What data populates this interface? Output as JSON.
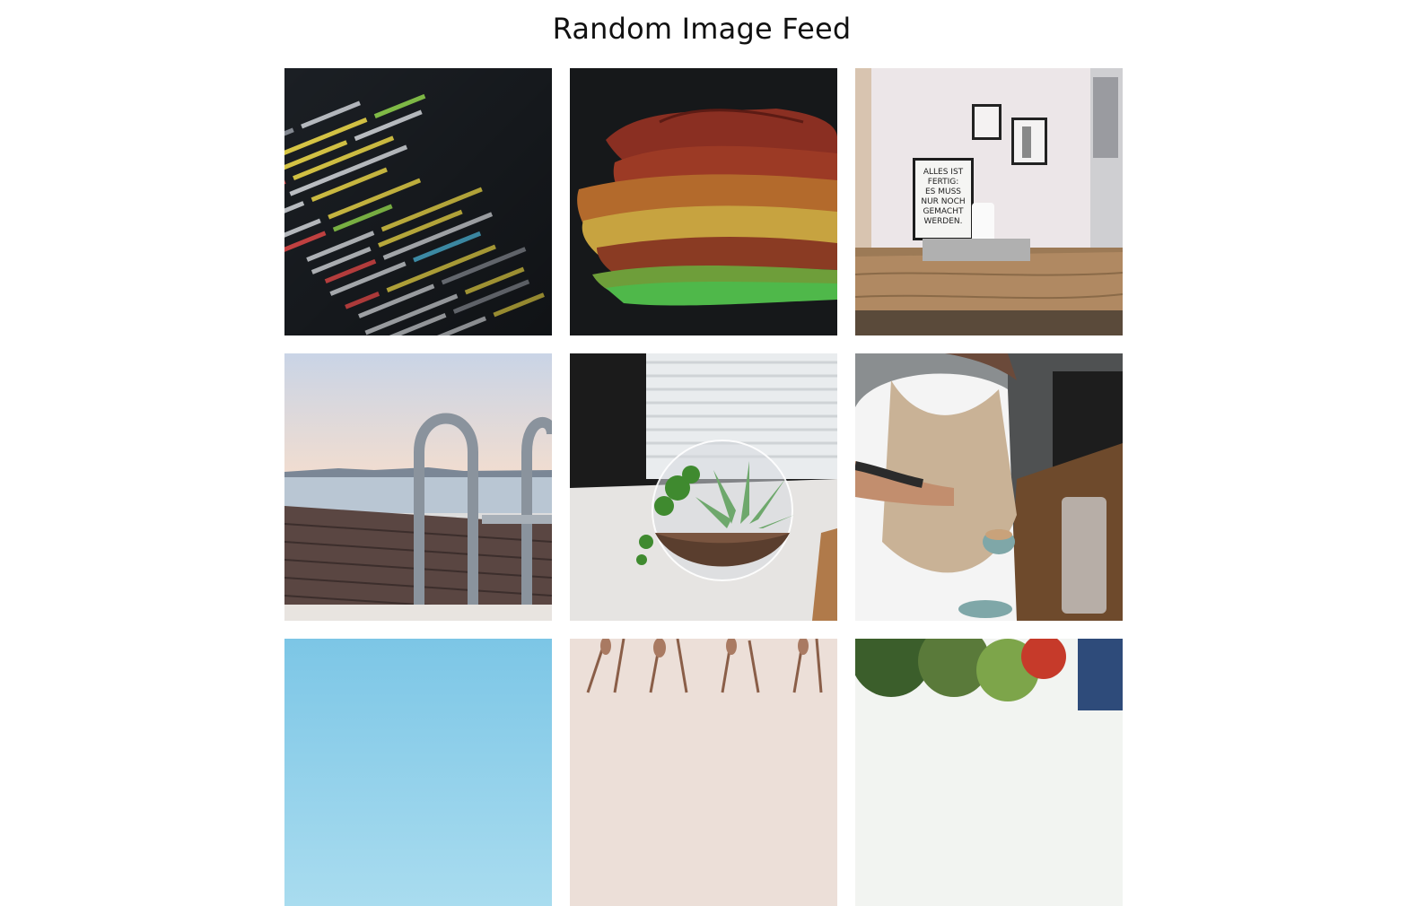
{
  "page": {
    "title": "Random Image Feed"
  },
  "feed": {
    "images": [
      {
        "subject": "code-editor-photo"
      },
      {
        "subject": "dried-leaves-photo"
      },
      {
        "subject": "office-desk-photo",
        "poster_text": [
          "ALLES IST",
          "FERTIG:",
          "ES MUSS",
          "NUR NOCH",
          "GEMACHT",
          "WERDEN."
        ]
      },
      {
        "subject": "pier-ladder-photo"
      },
      {
        "subject": "terrarium-plant-photo"
      },
      {
        "subject": "barista-coffee-photo"
      },
      {
        "subject": "blue-sky-photo"
      },
      {
        "subject": "dry-grass-photo"
      },
      {
        "subject": "trees-garden-photo"
      }
    ]
  },
  "colors": {
    "background": "#ffffff",
    "title": "#111111"
  }
}
